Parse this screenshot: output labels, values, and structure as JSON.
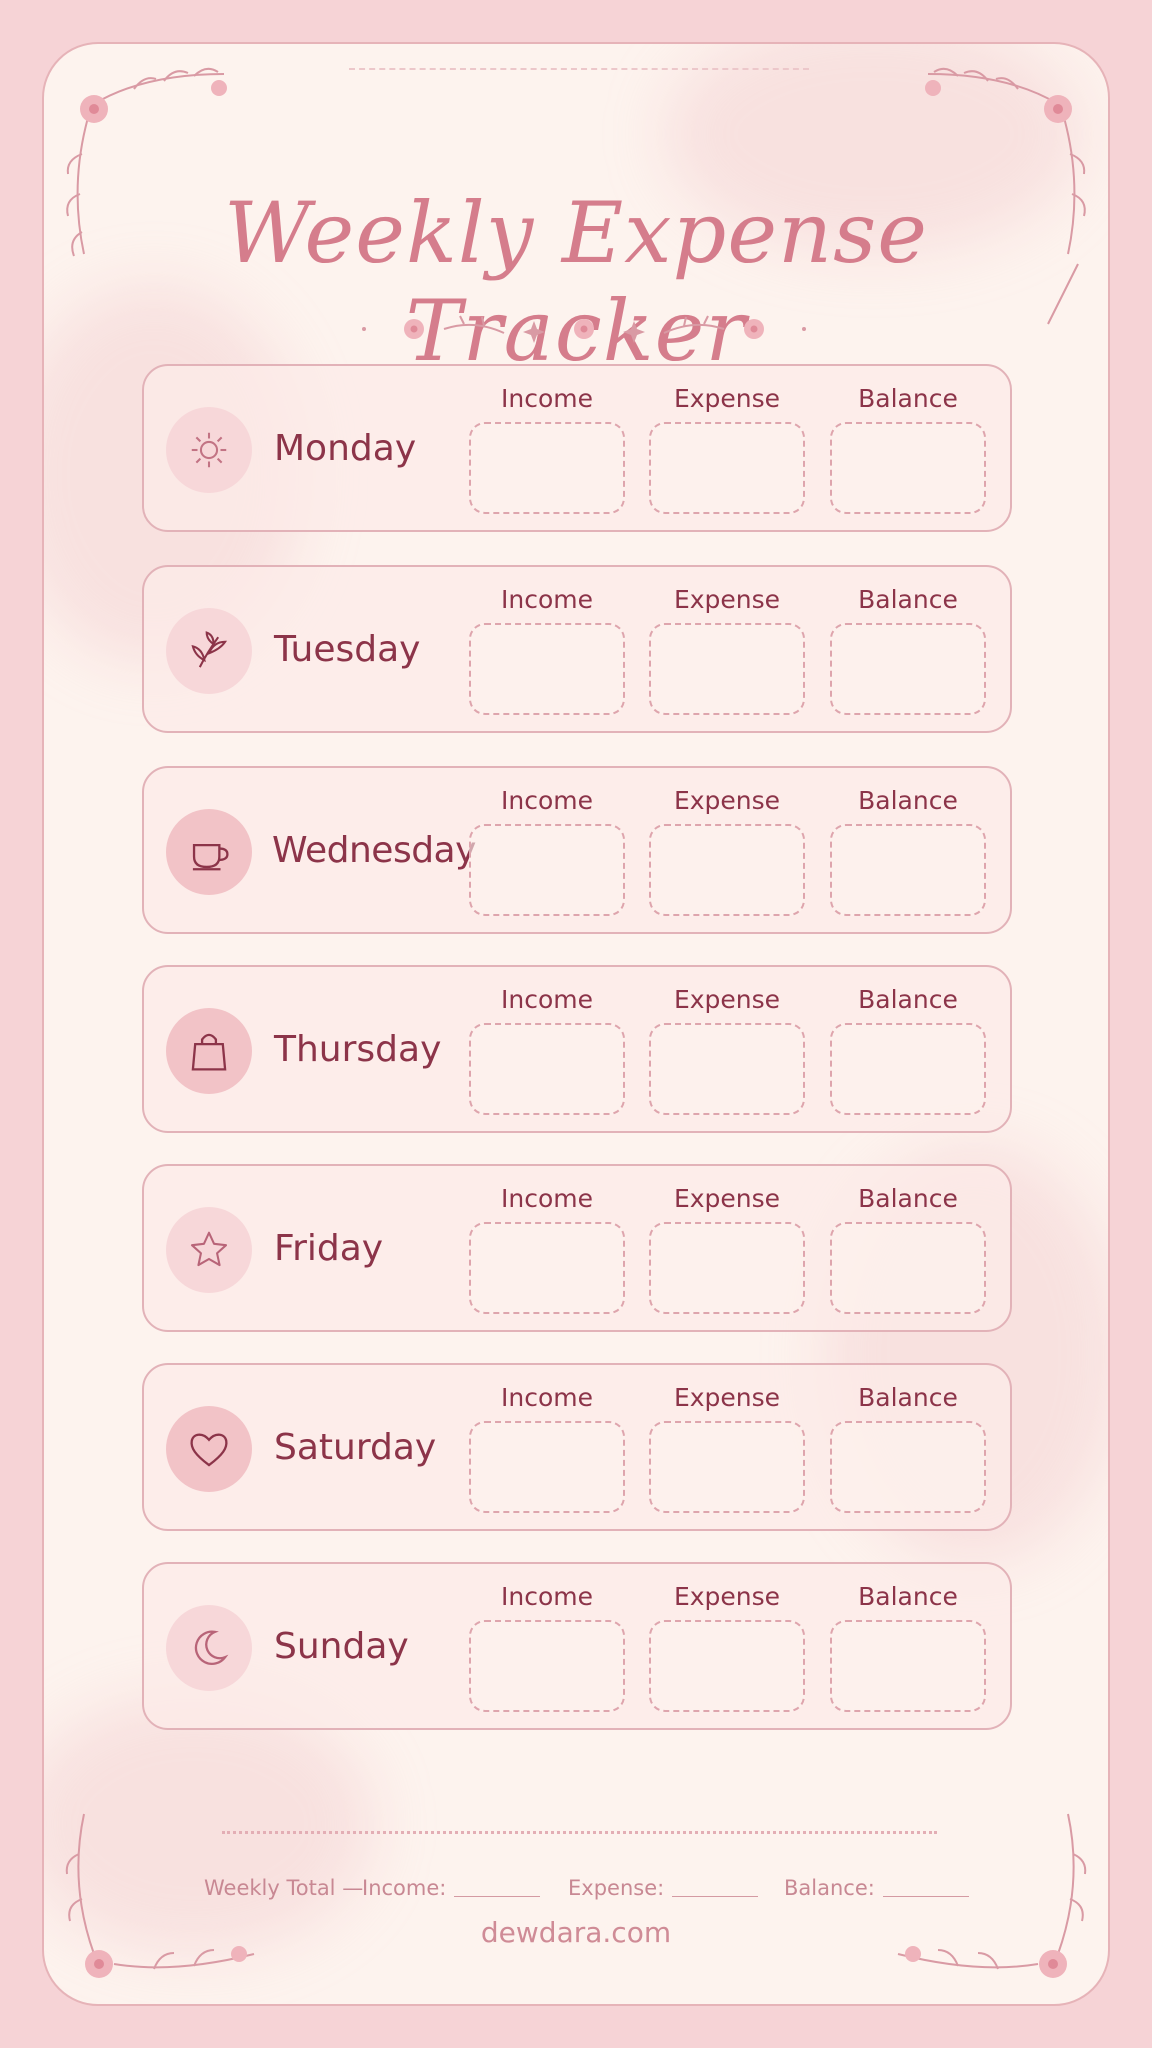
{
  "title": "Weekly Expense Tracker",
  "columns": {
    "income": "Income",
    "expense": "Expense",
    "balance": "Balance"
  },
  "days": [
    {
      "name": "Monday",
      "icon": "sun-icon"
    },
    {
      "name": "Tuesday",
      "icon": "leaf-sprig-icon"
    },
    {
      "name": "Wednesday",
      "icon": "coffee-cup-icon"
    },
    {
      "name": "Thursday",
      "icon": "shopping-bag-icon"
    },
    {
      "name": "Friday",
      "icon": "star-icon"
    },
    {
      "name": "Saturday",
      "icon": "heart-icon"
    },
    {
      "name": "Sunday",
      "icon": "moon-icon"
    }
  ],
  "weekly_total": {
    "label": "Weekly Total —",
    "income": "Income:",
    "expense": "Expense:",
    "balance": "Balance:"
  },
  "footer": "dewdara.com",
  "colors": {
    "page_border": "#f6d3d6",
    "card": "#fdf3ee",
    "title": "#d57d8c",
    "text": "#8c3449",
    "row_border": "#e2b2b8"
  }
}
